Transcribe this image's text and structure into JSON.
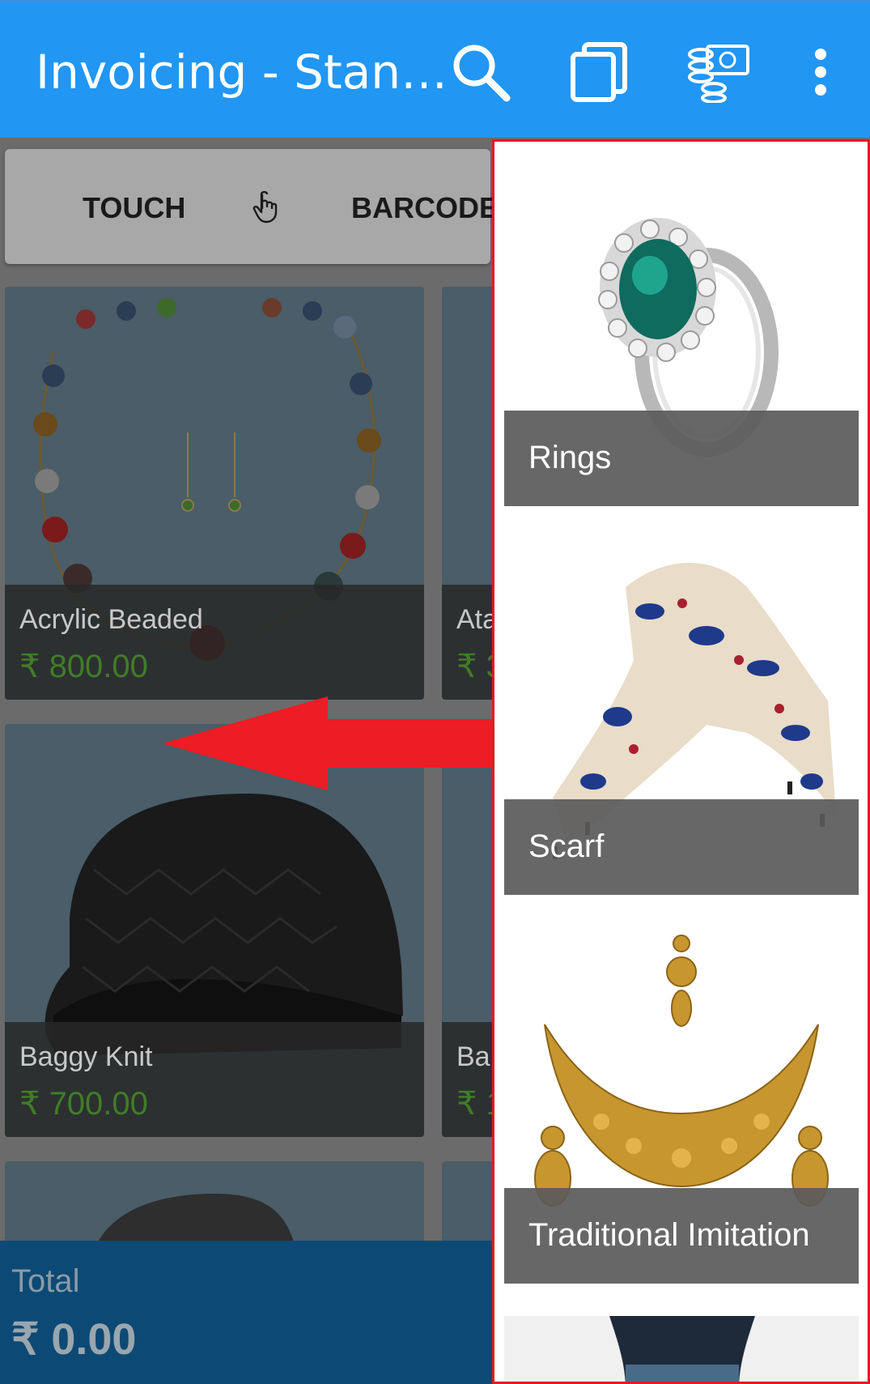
{
  "appbar": {
    "title": "Invoicing - Stan…",
    "icons": [
      "search-icon",
      "copy-icon",
      "cash-coins-icon",
      "overflow-menu-icon"
    ]
  },
  "tabs": {
    "touch_label": "TOUCH",
    "barcode_label": "BARCODE",
    "hand_icon": "touch-hand-icon"
  },
  "products": [
    {
      "name": "Acrylic Beaded",
      "price": "₹ 800.00"
    },
    {
      "name": "Ata",
      "price": "₹ 3"
    },
    {
      "name": "Baggy Knit",
      "price": "₹ 700.00"
    },
    {
      "name": "Ba",
      "price": "₹ 1"
    }
  ],
  "total": {
    "label": "Total",
    "value": "₹ 0.00"
  },
  "categories": [
    {
      "label": "Rings"
    },
    {
      "label": "Scarf"
    },
    {
      "label": "Traditional Imitation"
    }
  ],
  "colors": {
    "appbar": "#2196f3",
    "drawer_border": "#e01c24",
    "price_green": "#3f7d27",
    "total_bar": "#0c4a75"
  }
}
